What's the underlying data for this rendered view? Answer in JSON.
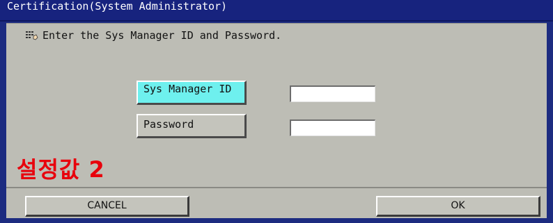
{
  "window": {
    "title": "Certification(System Administrator)"
  },
  "dialog": {
    "instruction": "Enter the Sys Manager ID and Password.",
    "instruction_icon": "keyboard-hand-icon",
    "fields": {
      "id_label": "Sys Manager ID",
      "id_value": "",
      "password_label": "Password",
      "password_value": ""
    },
    "overlay_annotation": "설정값 2"
  },
  "footer": {
    "cancel_label": "CANCEL",
    "ok_label": "OK"
  },
  "colors": {
    "title_bar": "#17237e",
    "dialog_bg": "#bdbdb5",
    "active_field": "#6ef0ee",
    "annotation": "#e8000c"
  }
}
